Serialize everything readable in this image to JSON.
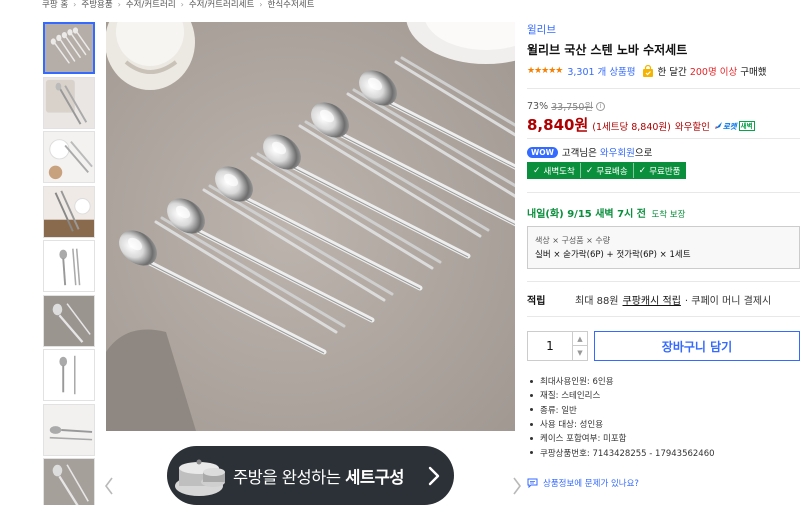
{
  "breadcrumb": [
    "쿠팡 홈",
    "주방용품",
    "수저/커트러리",
    "수저/커트러리세트",
    "한식수저세트"
  ],
  "breadcrumb_sep": "›",
  "product": {
    "brand": "윌리브",
    "title": "윌리브 국산 스텐 노바 수저세트",
    "stars": "★★★★★",
    "review_count": "3,301 개 상품평",
    "buy_prefix": "한 달간",
    "buy_highlight": "200명 이상",
    "buy_suffix": "구매했",
    "discount_rate": "73%",
    "original_price": "33,750원",
    "info_symbol": "i",
    "price": "8,840원",
    "unit_price": "(1세트당 8,840원)",
    "wow_sale": "와우할인",
    "rocket_label": "로켓",
    "rocket_new": "새벽"
  },
  "wow": {
    "badge": "WOW",
    "text_prefix": "고객님은 ",
    "text_highlight": "와우회원",
    "text_suffix": "으로",
    "benefits": [
      "새벽도착",
      "무료배송",
      "무료반품"
    ],
    "check": "✓"
  },
  "delivery": {
    "date": "내일(화) 9/15 새벽 7시 전",
    "sub": "도착 보장"
  },
  "option": {
    "label": "색상 × 구성품 × 수량",
    "value": "실버 × 숟가락(6P) + 젓가락(6P) × 1세트"
  },
  "reward": {
    "label": "적립",
    "text": "최대 88원",
    "link": "쿠팡캐시 적립",
    "tail": "· 쿠페이 머니 결제시"
  },
  "quantity": {
    "value": "1",
    "up": "▲",
    "down": "▼"
  },
  "cart_button": "장바구니 담기",
  "specs": [
    "최대사용인원: 6인용",
    "재질: 스테인리스",
    "종류: 일반",
    "사용 대상: 성인용",
    "케이스 포함여부: 미포함",
    "쿠팡상품번호: 7143428255 - 17943562460"
  ],
  "report_link": "상품정보에 문제가 있나요?",
  "banner": {
    "text_light": "주방을 완성하는 ",
    "text_bold": "세트구성"
  },
  "nav": {
    "prev": "‹",
    "next": "›"
  },
  "colors": {
    "accent_blue": "#346aff",
    "price_red": "#ae0000",
    "rocket_green": "#0a8f3c",
    "star_orange": "#f57f00",
    "background_tabletop": "#b3aba5"
  }
}
